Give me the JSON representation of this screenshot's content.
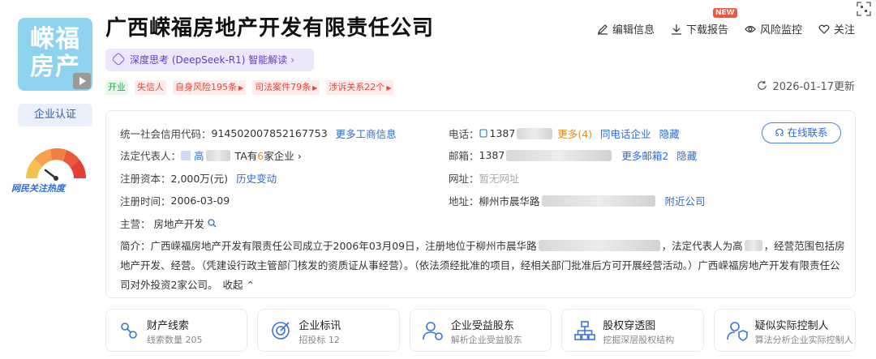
{
  "company": {
    "logo_text": "嵘福房产",
    "name": "广西嵘福房地产开发有限责任公司",
    "deepseek_label": "深度思考 (DeepSeek-R1) 智能解读",
    "tags": [
      {
        "label": "开业",
        "color": "green"
      },
      {
        "label": "失信人",
        "color": "red"
      },
      {
        "label": "自身风险195条",
        "color": "red",
        "arrow": true
      },
      {
        "label": "司法案件79条",
        "color": "red",
        "arrow": true
      },
      {
        "label": "涉诉关系22个",
        "color": "red",
        "arrow": true
      }
    ],
    "update_date": "2026-01-17更新"
  },
  "sidebar": {
    "cert_label": "企业认证",
    "heat_label": "网民关注热度"
  },
  "actions": {
    "edit": "编辑信息",
    "download": "下载报告",
    "new_badge": "NEW",
    "monitor": "风险监控",
    "follow": "关注"
  },
  "info": {
    "credit_code_label": "统一社会信用代码：",
    "credit_code": "914502007852167753",
    "more_business": "更多工商信息",
    "legal_rep_label": "法定代表人：",
    "legal_rep_name": "高",
    "ta_prefix": "TA有",
    "ta_count": "6",
    "ta_suffix": "家企业",
    "capital_label": "注册资本：",
    "capital": "2,000万(元)",
    "history_link": "历史变动",
    "reg_date_label": "注册时间：",
    "reg_date": "2006-03-09",
    "main_business_label": "主营：",
    "main_business": "房地产开发",
    "phone_label": "电话：",
    "phone": "1387",
    "more_phone": "更多(4)",
    "same_phone": "同电话企业",
    "hide": "隐藏",
    "email_label": "邮箱：",
    "email": "1387",
    "more_email": "更多邮箱2",
    "website_label": "网址：",
    "website": "暂无网址",
    "address_label": "地址：",
    "address": "柳州市晨华路",
    "nearby": "附近公司",
    "online_contact": "在线联系",
    "intro_label": "简介：",
    "intro_part1": "广西嵘福房地产开发有限责任公司成立于2006年03月09日，注册地位于柳州市晨华路",
    "intro_part2": "，法定代表人为高",
    "intro_part3": "，经营范围包括房地产开发、经营。（凭建设行政主管部门核发的资质证从事经营）。（依法须经批准的项目，经相关部门批准后方可开展经营活动。）广西嵘福房地产开发有限责任公司对外投资2家公司。",
    "collapse": "收起"
  },
  "features": [
    {
      "title": "财产线索",
      "sub": "线索数量 205",
      "icon": "property-clue-icon"
    },
    {
      "title": "企业标讯",
      "sub": "招投标 12",
      "icon": "bidding-icon"
    },
    {
      "title": "企业受益股东",
      "sub": "解析企业受益股东",
      "icon": "beneficiary-icon"
    },
    {
      "title": "股权穿透图",
      "sub": "挖掘深层股权结构",
      "icon": "equity-structure-icon"
    },
    {
      "title": "疑似实际控制人",
      "sub": "算法分析企业实际控制人",
      "icon": "controller-icon"
    }
  ],
  "colors": {
    "brand_blue": "#2d6bd9",
    "logo_bg": "#8ed3ee",
    "risk_red": "#e5493e",
    "open_green": "#2fa149",
    "ai_purple": "#5a3fcf"
  }
}
